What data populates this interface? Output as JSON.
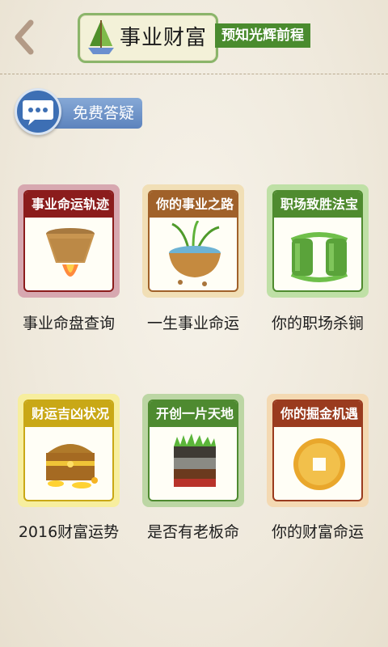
{
  "header": {
    "title": "事业财富",
    "tagline": "预知光辉前程"
  },
  "faq": {
    "label": "免费答疑"
  },
  "cards": [
    {
      "banner": "事业命运轨迹",
      "caption": "事业命盘查询",
      "icon": "flowerpot-rocket-icon",
      "frame_color": "#d7a8b0",
      "banner_color": "#8b1c1c"
    },
    {
      "banner": "你的事业之路",
      "caption": "一生事业命运",
      "icon": "sprout-pot-icon",
      "frame_color": "#f1dfb6",
      "banner_color": "#a0612a"
    },
    {
      "banner": "职场致胜法宝",
      "caption": "你的职场杀锏",
      "icon": "jade-bracelets-icon",
      "frame_color": "#bfe0a6",
      "banner_color": "#4f8b2f"
    },
    {
      "banner": "财运吉凶状况",
      "caption": "2016财富运势",
      "icon": "treasure-chest-icon",
      "frame_color": "#f7ee9e",
      "banner_color": "#c9a816"
    },
    {
      "banner": "开创一片天地",
      "caption": "是否有老板命",
      "icon": "soil-layers-icon",
      "frame_color": "#bcd6a4",
      "banner_color": "#4e8a30"
    },
    {
      "banner": "你的掘金机遇",
      "caption": "你的财富命运",
      "icon": "gold-coin-icon",
      "frame_color": "#f4d9b2",
      "banner_color": "#9a3b1e"
    }
  ]
}
